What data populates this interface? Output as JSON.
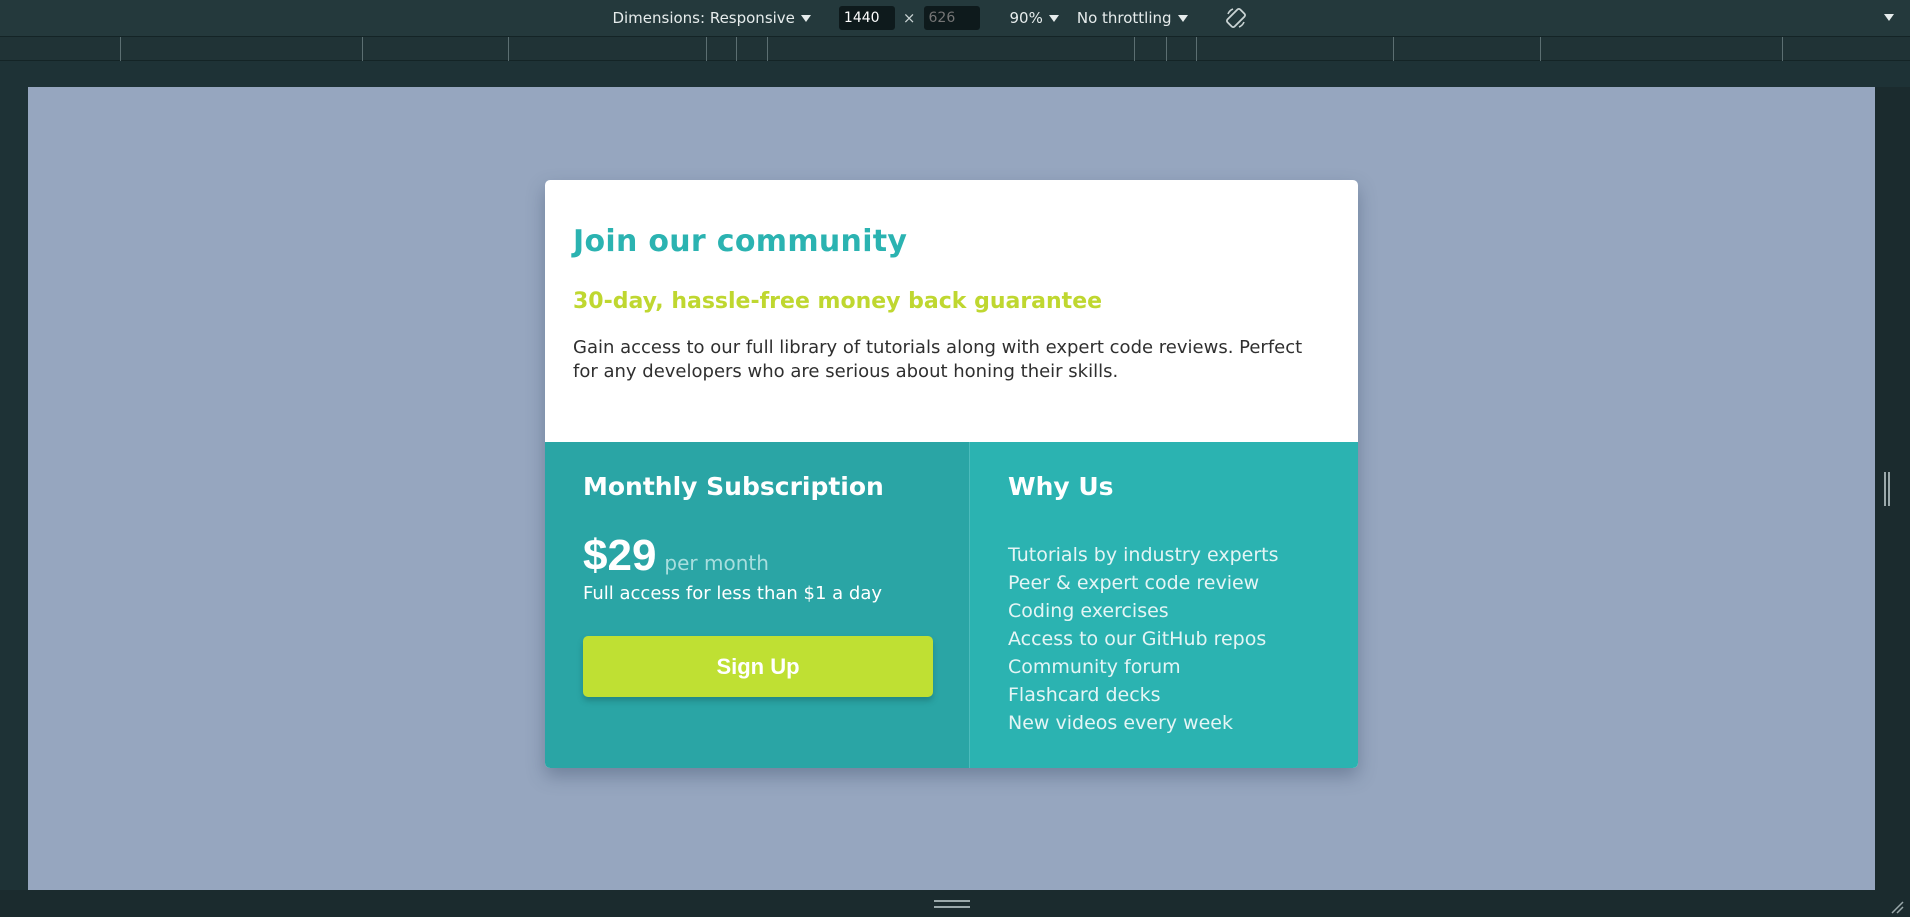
{
  "devtools": {
    "dimensions_label": "Dimensions: Responsive",
    "width_value": "1440",
    "height_placeholder": "626",
    "times_symbol": "×",
    "zoom_label": "90%",
    "throttling_label": "No throttling",
    "icons": {
      "rotate": "rotate-icon",
      "caret": "chevron-down-icon"
    }
  },
  "card": {
    "title": "Join our community",
    "subtitle": "30-day, hassle-free money back guarantee",
    "description": "Gain access to our full library of tutorials along with expert code reviews. Perfect for any developers who are serious about honing their skills.",
    "subscription": {
      "title": "Monthly Subscription",
      "price": "$29",
      "per": "per month",
      "access_note": "Full access for less than $1 a day",
      "cta_label": "Sign Up"
    },
    "why_us": {
      "title": "Why Us",
      "items": [
        "Tutorials by industry experts",
        "Peer & expert code review",
        "Coding exercises",
        "Access to our GitHub repos",
        "Community forum",
        "Flashcard decks",
        "New videos every week"
      ]
    }
  },
  "colors": {
    "viewport_background": "#96a6bf",
    "accent_teal": "#2bb3b1",
    "accent_teal_dark": "#2aa5a5",
    "accent_lime": "#bfe033",
    "devtools_background": "#24393c"
  }
}
